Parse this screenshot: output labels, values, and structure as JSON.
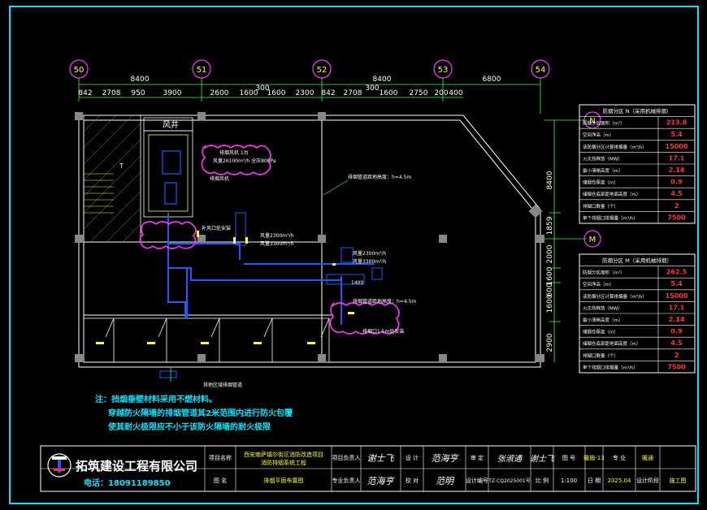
{
  "drawing": {
    "axes": [
      "50",
      "51",
      "52",
      "53",
      "54"
    ],
    "top_dims_major": [
      "8400",
      "8400",
      "6800"
    ],
    "top_dims_minor": [
      "842",
      "2708",
      "950",
      "3900",
      "2600",
      "1600",
      "300",
      "1600",
      "2300",
      "842",
      "2708",
      "300",
      "1600",
      "2750",
      "200",
      "400"
    ],
    "right_grid_labels": [
      "N",
      "M"
    ],
    "right_dims": [
      "8400",
      "1859",
      "2000",
      "1600",
      "600",
      "1600",
      "2900"
    ],
    "stair_label": "风井",
    "shaft_label": "T",
    "annotations": {
      "pink_1": "排烟风机 1台",
      "pink_1b": "风量26100m³/h  全压800Pa",
      "pink_2": "补风口处安装",
      "pink_3": "排烟口1.5m处安装",
      "smoke_fan": "排烟风机",
      "duct_height_1": "排烟管道距地高度：h=4.5m",
      "duct_height_2": "排烟管道距地高度：h=4.5m",
      "outlet_1": "风量2300m³/h",
      "outlet_2": "风量3300m³/h",
      "duct_size": "1400",
      "bottom_note": "其他区域排烟管道"
    },
    "tables": [
      {
        "title": "防烟分区 N（采用机械排烟）",
        "rows": [
          {
            "label": "防烟分区面积（m²）",
            "value": "213.8"
          },
          {
            "label": "空间净高（m）",
            "value": "5.4"
          },
          {
            "label": "该防烟分区计算排烟量（m³/h）",
            "value": "15000"
          },
          {
            "label": "火灾热释放（MW）",
            "value": "17.1"
          },
          {
            "label": "最小清晰高度（m）",
            "value": "2.14"
          },
          {
            "label": "储烟仓厚度（m）",
            "value": "0.9"
          },
          {
            "label": "储烟仓底部距地面高度（m）",
            "value": "4.5"
          },
          {
            "label": "排烟口数量（个）",
            "value": "2"
          },
          {
            "label": "单个排烟口排烟量（m³/h）",
            "value": "7500"
          }
        ]
      },
      {
        "title": "防烟分区 M（采用机械排烟）",
        "rows": [
          {
            "label": "防烟分区面积（m²）",
            "value": "262.5"
          },
          {
            "label": "空间净高（m）",
            "value": "5.4"
          },
          {
            "label": "该防烟分区计算排烟量（m³/h）",
            "value": "15000"
          },
          {
            "label": "火灾热释放（MW）",
            "value": "17.1"
          },
          {
            "label": "最小清晰高度（m）",
            "value": "2.14"
          },
          {
            "label": "储烟仓厚度（m）",
            "value": "0.9"
          },
          {
            "label": "储烟仓底部距地面高度（m）",
            "value": "4.5"
          },
          {
            "label": "排烟口数量（个）",
            "value": "2"
          },
          {
            "label": "单个排烟口排烟量（m³/h）",
            "value": "7500"
          }
        ]
      }
    ],
    "notes": [
      "注：挡烟垂壁材料采用不燃材料。",
      "穿越防火隔墙的排烟管道其2米范围内进行防火包覆",
      "使其耐火极限应不小于该防火隔墙的耐火极限"
    ]
  },
  "title_block": {
    "company": "拓筑建设工程有限公司",
    "phone": "电话：18091189850",
    "project_name_label": "项目名称",
    "project_name": "西安南萨镇尔街区消防改造项目",
    "project_name_2": "消防排烟系统工程",
    "drawing_name_label": "图 名",
    "drawing_name": "排烟平面布置图",
    "owner_label": "项目负责人",
    "owner_sign": "谢士飞",
    "pro_label": "专业负责人",
    "pro_sign": "范海亨",
    "design_label": "设 计",
    "design_sign": "范海亨",
    "check_label": "校 对",
    "check_sign": "范明",
    "review_label": "审 定",
    "review_sign": "张淑通",
    "approve_sign": "谢士飞",
    "sheet_label": "图 号",
    "sheet_no": "暖施-13",
    "design_no_label": "设计编号",
    "design_no": "TZ-CQ2025001号",
    "scale_label": "比 例",
    "scale": "1:100",
    "date_label": "日 期",
    "date": "2025.04",
    "major_label": "专 业",
    "major": "暖通",
    "stage_label": "设计阶段",
    "stage": "施工图"
  },
  "colors": {
    "frame": "#00e5ff",
    "wall": "#ffffff",
    "duct": "#1a5cff",
    "pink": "#ff33ff",
    "dim": "#33ff33",
    "note": "#00e5ff",
    "table_line": "#ffffff",
    "table_value": "#ff3333"
  }
}
